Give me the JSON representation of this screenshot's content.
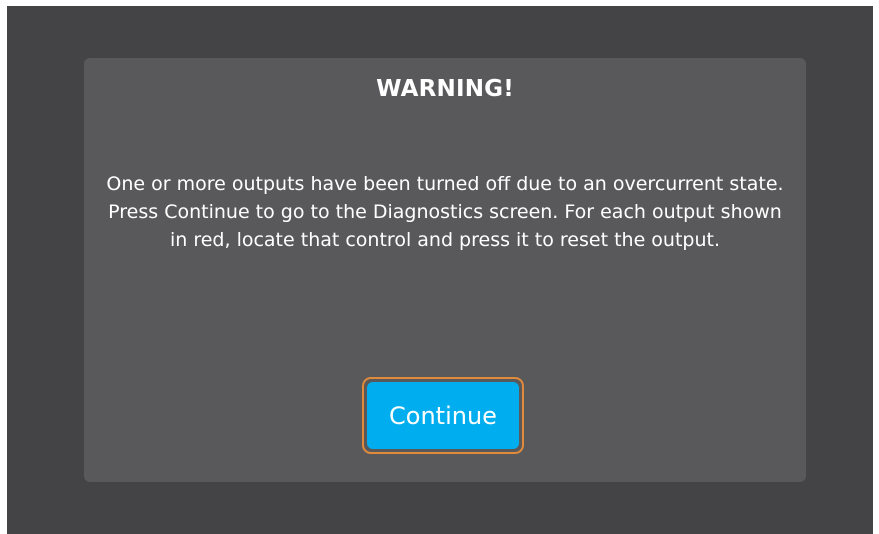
{
  "dialog": {
    "title": "WARNING!",
    "message": "One or more outputs have been turned off due to an overcurrent state. Press Continue to go to the Diagnostics screen. For each output shown in red, locate that control and press it to reset the output.",
    "continue_label": "Continue"
  },
  "colors": {
    "background": "#444446",
    "dialog": "#59595b",
    "button": "#00aeef",
    "focus_ring": "#e08a3c"
  }
}
